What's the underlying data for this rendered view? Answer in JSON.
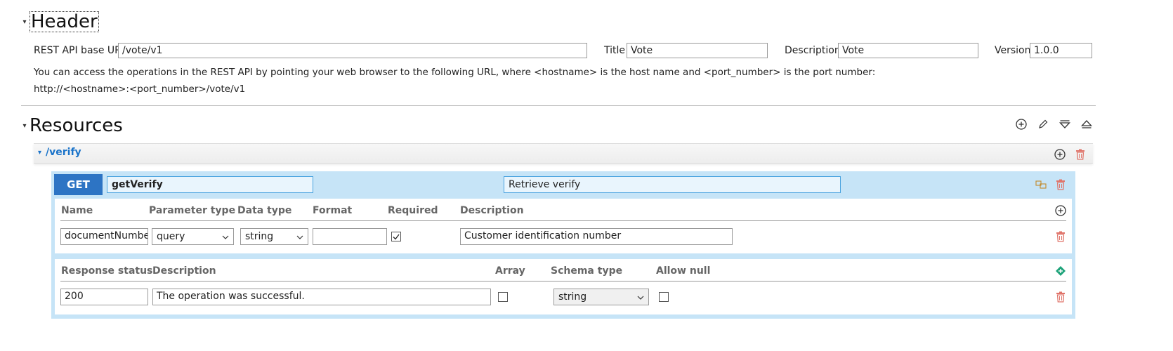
{
  "header": {
    "title": "Header",
    "base_url_label": "REST API base URL",
    "base_url_value": "/vote/v1",
    "title_label": "Title",
    "title_value": "Vote",
    "description_label": "Description",
    "description_value": "Vote",
    "version_label": "Version",
    "version_value": "1.0.0",
    "info_text": "You can access the operations in the REST API by pointing your web browser to the following URL, where <hostname> is the host name and <port_number> is the port number:",
    "url_text": "http://<hostname>:<port_number>/vote/v1"
  },
  "resources": {
    "title": "Resources",
    "toolbar_icons": [
      "add-circle-icon",
      "pencil-icon",
      "collapse-all-icon",
      "expand-all-icon"
    ],
    "resource": {
      "path": "/verify",
      "operation": {
        "method": "GET",
        "name": "getVerify",
        "summary": "Retrieve verify",
        "param_headers": {
          "name": "Name",
          "parameter_type": "Parameter type",
          "data_type": "Data type",
          "format": "Format",
          "required": "Required",
          "description": "Description"
        },
        "params": [
          {
            "name": "documentNumber",
            "parameter_type": "query",
            "data_type": "string",
            "format": "",
            "required": true,
            "description": "Customer identification number"
          }
        ],
        "response_headers": {
          "status": "Response status",
          "description": "Description",
          "array": "Array",
          "schema_type": "Schema type",
          "allow_null": "Allow null"
        },
        "responses": [
          {
            "status": "200",
            "description": "The operation was successful.",
            "array": false,
            "schema_type": "string",
            "allow_null": false
          }
        ]
      }
    }
  },
  "colors": {
    "accent": "#2d74c4",
    "op_background": "#c6e4f7",
    "link": "#1a73c9",
    "delete": "#e0746a",
    "add_green": "#1fa37a"
  }
}
